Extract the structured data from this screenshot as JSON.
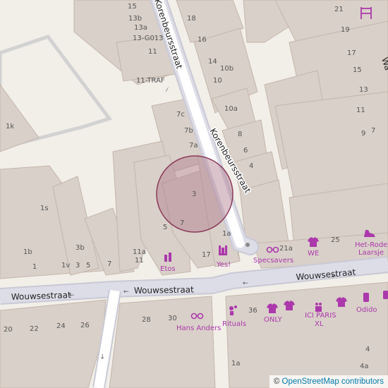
{
  "map": {
    "streets": {
      "korenbeursstraat": "Korenbeursstraat",
      "wouwsestraat_west": "Wouwsestraat",
      "wouwsestraat_mid": "Wouwsestraat",
      "wouwsestraat_east": "Wouwsestraat",
      "korenbeursstraat_top": "Korenbeursstraat",
      "wa_street_top_right": "Wa"
    },
    "house_numbers": {
      "n15": "15",
      "n13b": "13b",
      "n13a": "13a",
      "n13_g013": "13-G013",
      "n11_top": "11",
      "n11_traf": "11-TRAF",
      "n1k": "1k",
      "n1s": "1s",
      "n1b": "1b",
      "n1": "1",
      "n3b": "3b",
      "n1v": "1v",
      "n3": "3",
      "n5_left": "5",
      "n7_left": "7",
      "n11a": "11a",
      "n11_mid": "11",
      "n5_mid": "5",
      "n7_mid": "7",
      "n3_center": "3",
      "n17": "17",
      "n1a": "1a",
      "n7c": "7c",
      "n7b": "7b",
      "n7a": "7a",
      "n18": "18",
      "n16": "16",
      "n14": "14",
      "n10b": "10b",
      "n10": "10",
      "n10a": "10a",
      "n8": "8",
      "n6": "6",
      "n4": "4",
      "n21_top": "21",
      "n19": "19",
      "n17_right": "17",
      "n15_right": "15",
      "n13_right": "13",
      "n11_right": "11",
      "n9": "9",
      "n7_right": "7",
      "n21a": "21a",
      "n25": "25",
      "n20": "20",
      "n22": "22",
      "n24": "24",
      "n26": "26",
      "n28": "28",
      "n30": "30",
      "n36": "36",
      "n4_bottom": "4",
      "n1a_bottom": "1a",
      "n4a": "4a"
    },
    "pois": {
      "etos": "Etos",
      "yes": "Yes!",
      "specsavers": "Specsavers",
      "we": "WE",
      "het_rode_laarsje_l1": "Het-Rode",
      "het_rode_laarsje_l2": "Laarsje",
      "hans_anders": "Hans Anders",
      "rituals": "Rituals",
      "only": "ONLY",
      "ici_paris_l1": "ICI PARIS",
      "ici_paris_l2": "XL",
      "odido": "Odido"
    },
    "colors": {
      "background": "#f2efe9",
      "building": "#d9d0c9",
      "building_outline": "#c4b6ab",
      "pedestrian": "#dddde8",
      "road": "#ffffff",
      "shop_poi": "#ac39ac",
      "highlight_fill": "#b07a8c",
      "highlight_stroke": "#8b3a5a"
    }
  },
  "attribution": {
    "copyright_symbol": "©",
    "text": "OpenStreetMap contributors"
  }
}
